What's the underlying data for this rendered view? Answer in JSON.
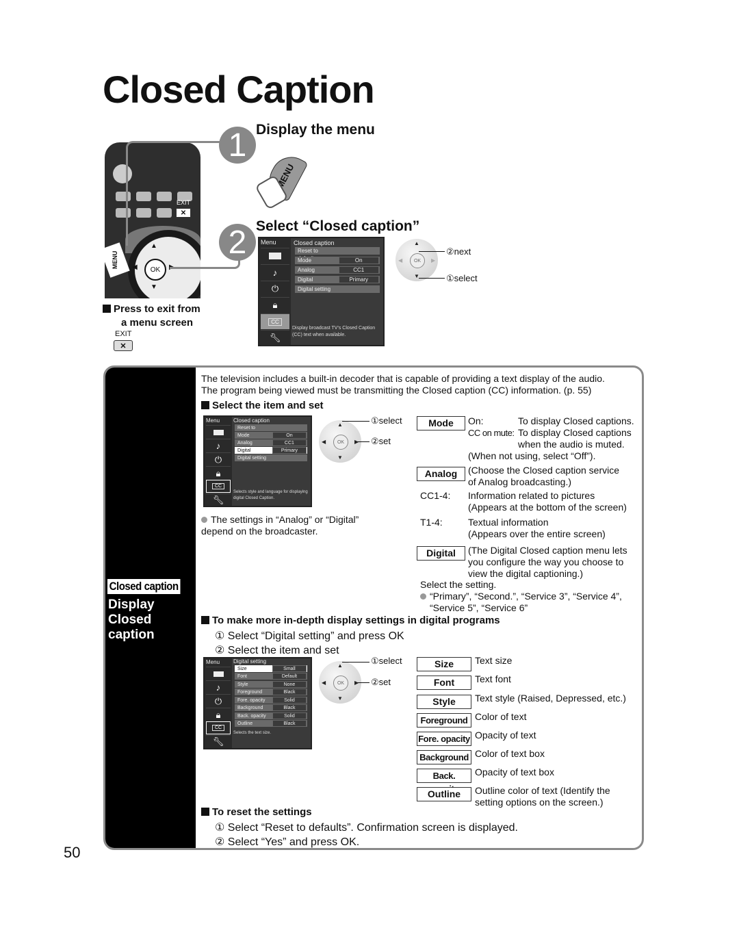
{
  "page": {
    "title": "Closed Caption",
    "page_number": "50"
  },
  "steps": [
    {
      "number": "1",
      "heading": "Display the menu",
      "button_label": "MENU"
    },
    {
      "number": "2",
      "heading": "Select “Closed caption”"
    }
  ],
  "remote": {
    "exit_label": "EXIT",
    "menu_label": "MENU",
    "ok_label": "OK",
    "exit_note_line1": "Press to exit from",
    "exit_note_line2": "a menu screen",
    "exit_key_label": "EXIT",
    "exit_glyph": "✕"
  },
  "menu_screen_1": {
    "side_label": "Menu",
    "header": "Closed caption",
    "rows": [
      {
        "key": "Reset to defaults",
        "value": ""
      },
      {
        "key": "Mode",
        "value": "On"
      },
      {
        "key": "Analog",
        "value": "CC1"
      },
      {
        "key": "Digital",
        "value": "Primary"
      },
      {
        "key": "Digital setting",
        "value": ""
      }
    ],
    "description": "Display broadcast TV’s Closed Caption (CC) text when available.",
    "icons": [
      "picture-icon",
      "audio-icon",
      "timer-icon",
      "lock-icon",
      "cc-icon",
      "setup-icon"
    ],
    "cc_label": "CC"
  },
  "nav_1": {
    "ok": "OK",
    "next": "②next",
    "select": "①select"
  },
  "intro": {
    "line1": "The television includes a built-in decoder that is capable of providing a text display of the audio.",
    "line2": "The program being viewed must be transmitting the Closed caption (CC) information. (p. 55)"
  },
  "sidebar": {
    "badge": "Closed caption",
    "title_line1": "Display",
    "title_line2": "Closed",
    "title_line3": "caption"
  },
  "section_select": {
    "heading": "Select the item and set",
    "menu": {
      "side_label": "Menu",
      "header": "Closed caption",
      "rows": [
        {
          "key": "Reset to defaults",
          "value": ""
        },
        {
          "key": "Mode",
          "value": "On"
        },
        {
          "key": "Analog",
          "value": "CC1"
        },
        {
          "key": "Digital",
          "value": "Primary",
          "selected": true
        },
        {
          "key": "Digital setting",
          "value": ""
        }
      ],
      "description": "Selects style and language for displaying digital Closed Caption.",
      "cc_label": "CC"
    },
    "nav": {
      "ok": "OK",
      "select": "①select",
      "set": "②set"
    },
    "note": "The settings in “Analog” or “Digital” depend on the broadcaster.",
    "mode": {
      "label": "Mode",
      "on_key": "On:",
      "on_desc": "To display Closed captions.",
      "mute_key": "CC on mute:",
      "mute_desc_1": "To display Closed captions",
      "mute_desc_2": "when the audio is muted.",
      "off_note": "(When not using, select “Off”)."
    },
    "analog": {
      "label": "Analog",
      "desc_1": "(Choose the Closed caption service",
      "desc_2": "of Analog broadcasting.)",
      "cc_key": "CC1-4:",
      "cc_desc_1": "Information related to pictures",
      "cc_desc_2": "(Appears at the bottom of the screen)",
      "t_key": "T1-4:",
      "t_desc_1": "Textual information",
      "t_desc_2": "(Appears over the entire screen)"
    },
    "digital": {
      "label": "Digital",
      "desc_1": "(The Digital Closed caption menu lets",
      "desc_2": "you configure the way you choose to",
      "desc_3": "view the digital captioning.)",
      "select_note": "Select the setting.",
      "options_1": "“Primary”, “Second.”, “Service 3”, “Service 4”,",
      "options_2": "“Service 5”, “Service 6”"
    }
  },
  "section_digital": {
    "heading": "To make more in-depth display settings in digital programs",
    "step1": "① Select “Digital setting” and press OK",
    "step2": "② Select the item and set",
    "menu": {
      "side_label": "Menu",
      "header": "Digital setting",
      "rows": [
        {
          "key": "Size",
          "value": "Small",
          "selected": true
        },
        {
          "key": "Font",
          "value": "Default"
        },
        {
          "key": "Style",
          "value": "None"
        },
        {
          "key": "Foreground",
          "value": "Black"
        },
        {
          "key": "Fore. opacity",
          "value": "Solid"
        },
        {
          "key": "Background",
          "value": "Black"
        },
        {
          "key": "Back. opacity",
          "value": "Solid"
        },
        {
          "key": "Outline",
          "value": "Black"
        }
      ],
      "description": "Selects the text size.",
      "cc_label": "CC"
    },
    "nav": {
      "ok": "OK",
      "select": "①select",
      "set": "②set"
    },
    "items": [
      {
        "label": "Size",
        "desc": "Text size"
      },
      {
        "label": "Font",
        "desc": "Text font"
      },
      {
        "label": "Style",
        "desc": "Text style (Raised, Depressed, etc.)"
      },
      {
        "label": "Foreground",
        "desc": "Color of text"
      },
      {
        "label": "Fore. opacity",
        "desc": "Opacity of text"
      },
      {
        "label": "Background",
        "desc": "Color of text box"
      },
      {
        "label": "Back. opacity",
        "desc": "Opacity of text box"
      },
      {
        "label": "Outline",
        "desc": "Outline color of text (Identify the",
        "desc_2": "setting options on the screen.)"
      }
    ]
  },
  "section_reset": {
    "heading": "To reset the settings",
    "step1": "① Select “Reset to defaults”. Confirmation screen is displayed.",
    "step2": "② Select “Yes” and press OK."
  }
}
